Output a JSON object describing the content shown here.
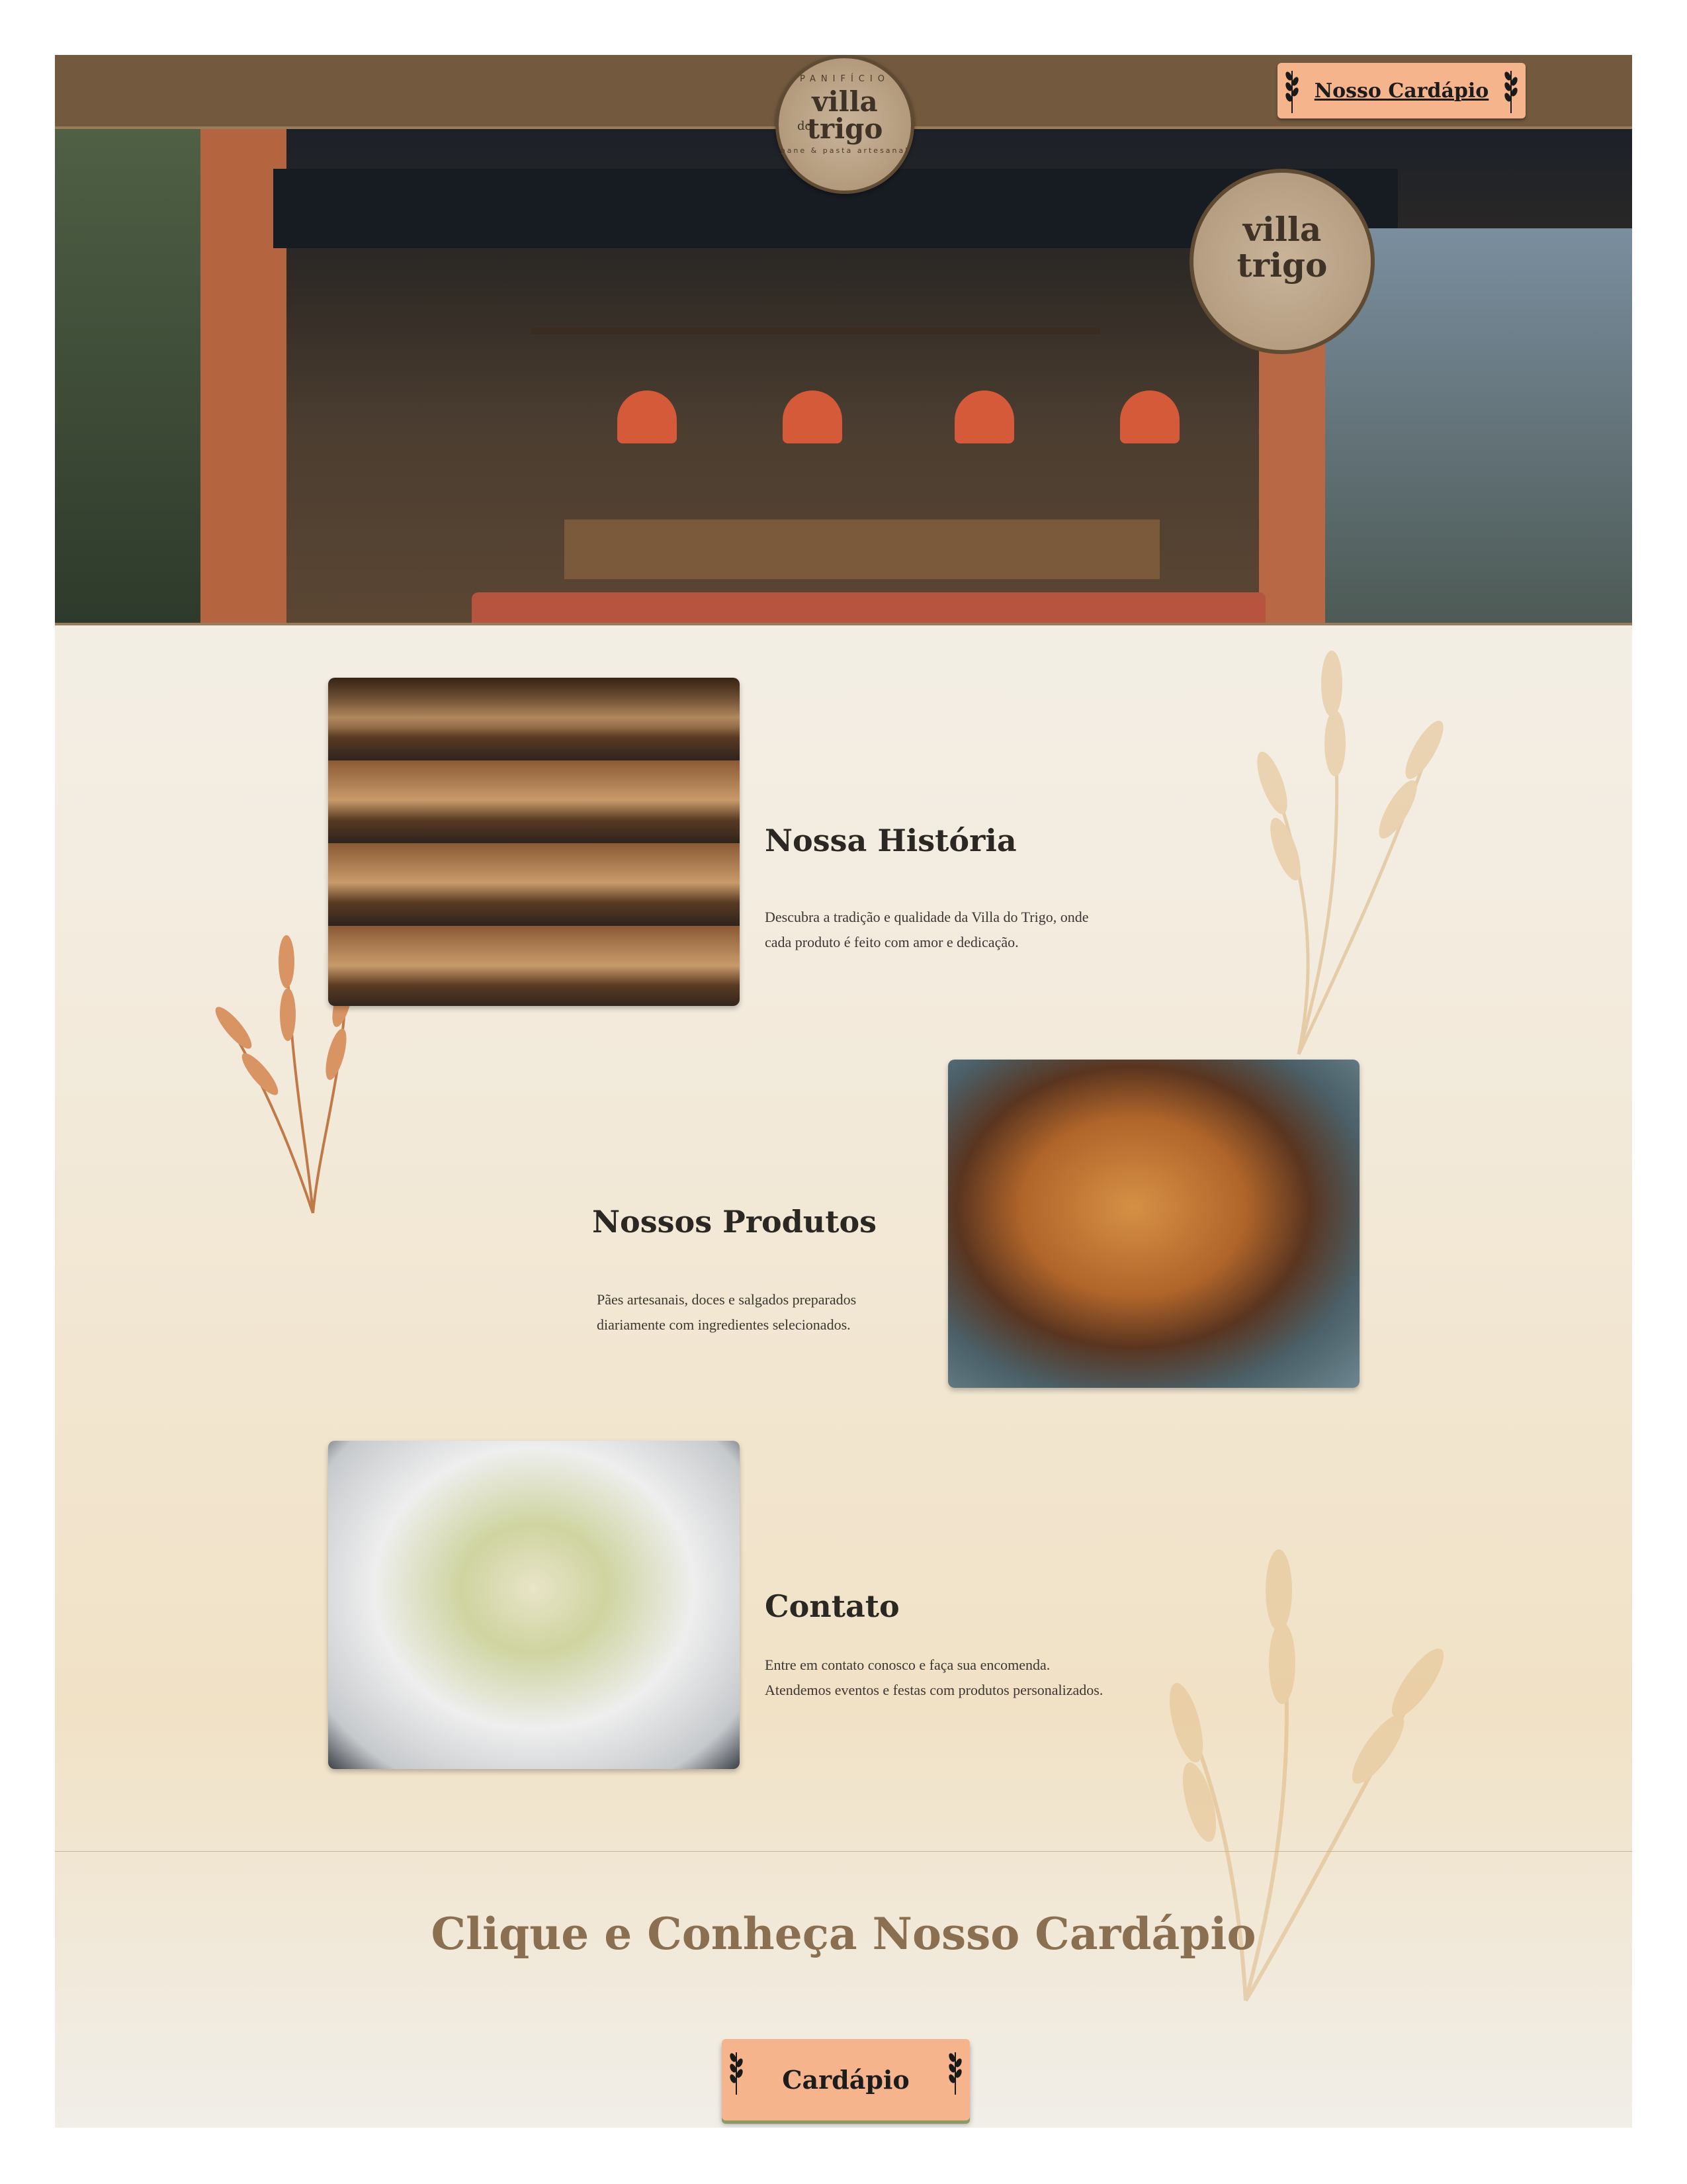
{
  "brand": {
    "logo_top": "PANIFÍCIO",
    "logo_villa": "villa",
    "logo_do": "do",
    "logo_trigo": "trigo",
    "logo_tagline": "pane & pasta artesanal"
  },
  "header": {
    "menu_button_label": "Nosso Cardápio"
  },
  "sections": [
    {
      "title": "Nossa História",
      "text": "Descubra a tradição e qualidade da Villa do Trigo, onde cada produto é feito com amor e dedicação."
    },
    {
      "title": "Nossos Produtos",
      "text": "Pães artesanais, doces e salgados preparados diariamente com ingredientes selecionados."
    },
    {
      "title": "Contato",
      "text": "Entre em contato conosco e faça sua encomenda. Atendemos eventos e festas com produtos personalizados."
    }
  ],
  "cta": {
    "title": "Clique e Conheça Nosso Cardápio",
    "button_label": "Cardápio"
  },
  "colors": {
    "header_bg": "#735a3f",
    "button_bg": "#f6b48d",
    "cta_title": "#8a7050"
  },
  "icons": {
    "wheat": "wheat-icon"
  }
}
